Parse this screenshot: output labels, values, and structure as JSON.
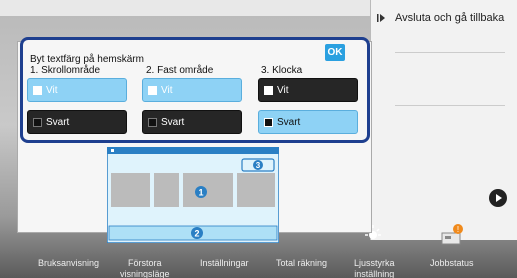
{
  "right_panel": {
    "back_label": "Avsluta och gå tillbaka"
  },
  "dialog": {
    "title": "Byt textfärg på hemskärm",
    "ok_label": "OK",
    "columns": [
      {
        "label": "1. Skrollområde",
        "white": "Vit",
        "black": "Svart"
      },
      {
        "label": "2. Fast område",
        "white": "Vit",
        "black": "Svart"
      },
      {
        "label": "3. Klocka",
        "white": "Vit",
        "black": "Svart"
      }
    ]
  },
  "preview": {
    "markers": [
      "1",
      "2",
      "3"
    ]
  },
  "dock": {
    "items": [
      {
        "label": "Bruksanvisning"
      },
      {
        "label": "Förstora\nvisningsläge"
      },
      {
        "label": "Inställningar"
      },
      {
        "label": "Total räkning"
      },
      {
        "label": "Ljusstyrka\ninställning"
      },
      {
        "label": "Jobbstatus"
      }
    ]
  },
  "colors": {
    "panel_border": "#1e3f8f",
    "selected": "#8ed2f5",
    "ok_button": "#2aa0e0"
  }
}
